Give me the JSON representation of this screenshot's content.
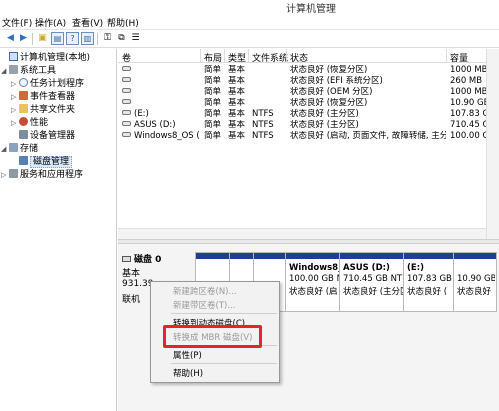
{
  "window": {
    "title": "计算机管理"
  },
  "menu": [
    {
      "label": "文件(F)"
    },
    {
      "label": "操作(A)"
    },
    {
      "label": "查看(V)"
    },
    {
      "label": "帮助(H)"
    }
  ],
  "toolbar": [
    {
      "icon": "back-arrow-icon",
      "glyph": "◀"
    },
    {
      "icon": "forward-arrow-icon",
      "glyph": "▶"
    },
    {
      "icon": "folder-up-icon",
      "glyph": "▣"
    },
    {
      "icon": "properties-icon",
      "glyph": "▤"
    },
    {
      "icon": "help-icon",
      "glyph": "?"
    },
    {
      "icon": "panel-icon",
      "glyph": "▥"
    },
    {
      "icon": "connect-icon",
      "glyph": "⚿"
    },
    {
      "icon": "export-icon",
      "glyph": "⧉"
    },
    {
      "icon": "list-icon",
      "glyph": "☰"
    }
  ],
  "tree": [
    {
      "label": "计算机管理(本地)",
      "icon": "computer-icon",
      "level": 0,
      "expander": ""
    },
    {
      "label": "系统工具",
      "icon": "tools-icon",
      "level": 1,
      "expander": "◢"
    },
    {
      "label": "任务计划程序",
      "icon": "clock-icon",
      "level": 2,
      "expander": "▷"
    },
    {
      "label": "事件查看器",
      "icon": "event-viewer-icon",
      "level": 2,
      "expander": "▷"
    },
    {
      "label": "共享文件夹",
      "icon": "shared-folder-icon",
      "level": 2,
      "expander": "▷"
    },
    {
      "label": "性能",
      "icon": "performance-icon",
      "level": 2,
      "expander": "▷"
    },
    {
      "label": "设备管理器",
      "icon": "device-manager-icon",
      "level": 2,
      "expander": ""
    },
    {
      "label": "存储",
      "icon": "storage-icon",
      "level": 1,
      "expander": "◢"
    },
    {
      "label": "磁盘管理",
      "icon": "disk-management-icon",
      "level": 2,
      "expander": "",
      "selected": true
    },
    {
      "label": "服务和应用程序",
      "icon": "services-icon",
      "level": 1,
      "expander": "▷"
    }
  ],
  "volumes": {
    "columns": [
      "卷",
      "布局",
      "类型",
      "文件系统",
      "状态",
      "容量"
    ],
    "rows": [
      {
        "name": "",
        "layout": "简单",
        "type": "基本",
        "fs": "",
        "status": "状态良好 (恢复分区)",
        "capacity": "1000 MB"
      },
      {
        "name": "",
        "layout": "简单",
        "type": "基本",
        "fs": "",
        "status": "状态良好 (EFI 系统分区)",
        "capacity": "260 MB"
      },
      {
        "name": "",
        "layout": "简单",
        "type": "基本",
        "fs": "",
        "status": "状态良好 (OEM 分区)",
        "capacity": "1000 MB"
      },
      {
        "name": "",
        "layout": "简单",
        "type": "基本",
        "fs": "",
        "status": "状态良好 (恢复分区)",
        "capacity": "10.90 GB"
      },
      {
        "name": "(E:)",
        "layout": "简单",
        "type": "基本",
        "fs": "NTFS",
        "status": "状态良好 (主分区)",
        "capacity": "107.83 GB"
      },
      {
        "name": "ASUS (D:)",
        "layout": "简单",
        "type": "基本",
        "fs": "NTFS",
        "status": "状态良好 (主分区)",
        "capacity": "710.45 GB"
      },
      {
        "name": "Windows8_OS (C:)",
        "layout": "简单",
        "type": "基本",
        "fs": "NTFS",
        "status": "状态良好 (启动, 页面文件, 故障转储, 主分区)",
        "capacity": "100.00 GB"
      }
    ]
  },
  "disk": {
    "name": "磁盘 0",
    "type": "基本",
    "size": "931.39",
    "state": "联机",
    "partitions": [
      {
        "title": "",
        "size": "",
        "status": ""
      },
      {
        "title": "",
        "size": "",
        "status": ""
      },
      {
        "title": "",
        "size": "",
        "status": ""
      },
      {
        "title": "Windows8_",
        "size": "100.00 GB N",
        "status": "状态良好 (启"
      },
      {
        "title": "ASUS  (D:)",
        "size": "710.45 GB NTFS",
        "status": "状态良好 (主分区)"
      },
      {
        "title": "(E:)",
        "size": "107.83 GB",
        "status": "状态良好 ("
      },
      {
        "title": "",
        "size": "10.90 GB",
        "status": "状态良好"
      }
    ]
  },
  "context_menu": [
    {
      "label": "新建跨区卷(N)...",
      "disabled": true
    },
    {
      "label": "新建带区卷(T)...",
      "disabled": true
    },
    {
      "label": "转换到动态磁盘(C)...",
      "disabled": false
    },
    {
      "label": "转换成 MBR 磁盘(V)",
      "disabled": true
    },
    {
      "label": "属性(P)",
      "disabled": false
    },
    {
      "label": "帮助(H)",
      "disabled": false
    }
  ],
  "colors": {
    "partition_band": "#1f3f8f",
    "highlight": "#e0262a",
    "selection": "#d9e9fb"
  }
}
